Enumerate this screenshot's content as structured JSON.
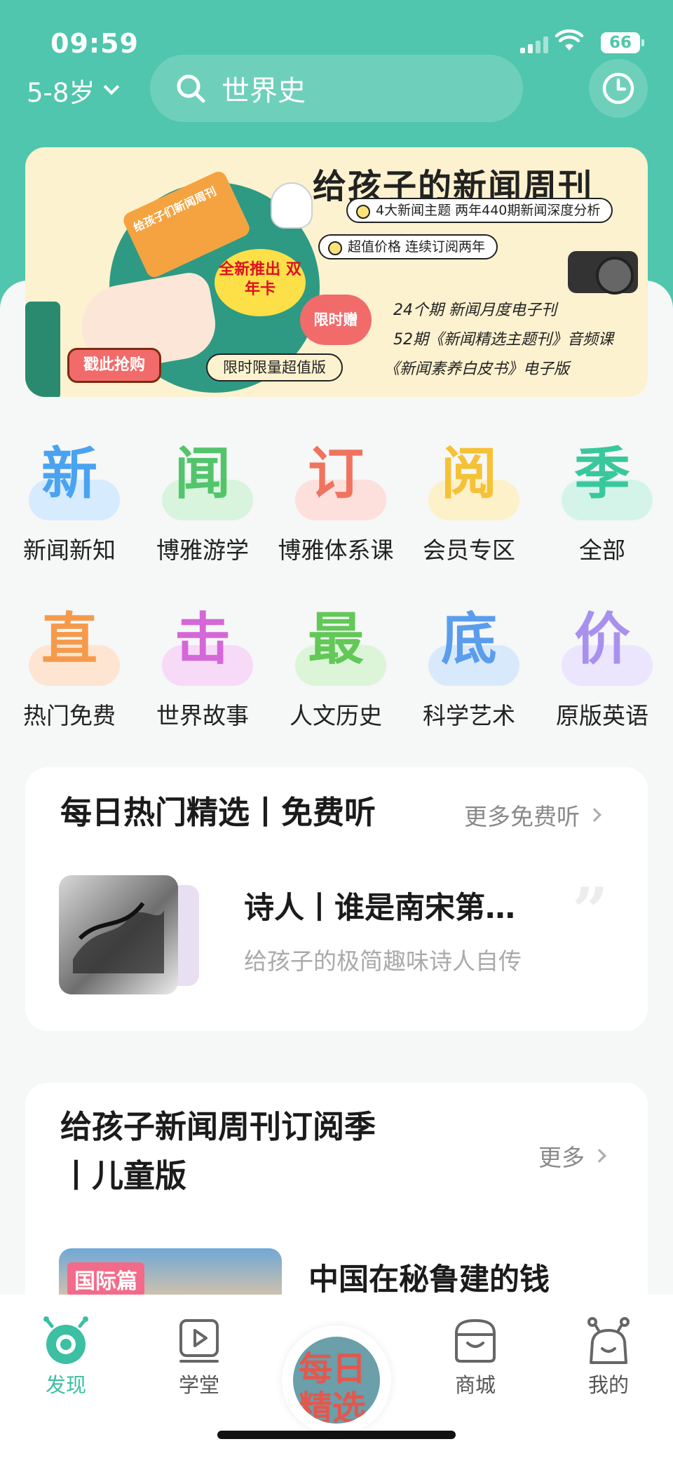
{
  "status": {
    "time": "09:59",
    "battery": "66"
  },
  "header": {
    "age_label": "5-8岁",
    "search_text": "世界史"
  },
  "banner": {
    "title": "给孩子的新闻周刊",
    "pill1": "4大新闻主题 两年440期新闻深度分析",
    "pill2": "超值价格 连续订阅两年",
    "badge": "全新推出 双年卡",
    "gift": "限时赠",
    "gift_line1": "24个期 新闻月度电子刊",
    "gift_line2": "52期《新闻精选主题刊》音频课",
    "gift_line3": "《新闻素养白皮书》电子版",
    "buy_button": "戳此抢购",
    "limit_text": "限时限量超值版",
    "card_text": "给孩子们新闻周刊"
  },
  "categories": [
    {
      "char": "新",
      "label": "新闻新知",
      "color": "#4aa3f0",
      "blob": "#d6ebfd"
    },
    {
      "char": "闻",
      "label": "博雅游学",
      "color": "#53c46b",
      "blob": "#d8f4dd"
    },
    {
      "char": "订",
      "label": "博雅体系课",
      "color": "#f0735f",
      "blob": "#fde0dc"
    },
    {
      "char": "阅",
      "label": "会员专区",
      "color": "#f5c237",
      "blob": "#fdf1c9"
    },
    {
      "char": "季",
      "label": "全部",
      "color": "#39c89c",
      "blob": "#d4f4ea"
    },
    {
      "char": "直",
      "label": "热门免费",
      "color": "#f59a4b",
      "blob": "#fde5d2"
    },
    {
      "char": "击",
      "label": "世界故事",
      "color": "#d468d8",
      "blob": "#f6daf7"
    },
    {
      "char": "最",
      "label": "人文历史",
      "color": "#62c857",
      "blob": "#dcf5d8"
    },
    {
      "char": "底",
      "label": "科学艺术",
      "color": "#5a9ded",
      "blob": "#d9e9fc"
    },
    {
      "char": "价",
      "label": "原版英语",
      "color": "#a891ee",
      "blob": "#ebe5fd"
    }
  ],
  "daily": {
    "title": "每日热门精选丨免费听",
    "more": "更多免费听",
    "item_title": "诗人丨谁是南宋第…",
    "item_sub": "给孩子的极简趣味诗人自传"
  },
  "weekly": {
    "title_line1": "给孩子新闻周刊订阅季",
    "title_line2": "丨儿童版",
    "more": "更多",
    "tag": "国际篇",
    "item_title": "中国在秘鲁建的钱"
  },
  "tabs": {
    "discover": "发现",
    "school": "学堂",
    "center_top": "每日",
    "center_bottom": "精选",
    "mall": "商城",
    "mine": "我的"
  },
  "colors": {
    "brand": "#4fc6ad",
    "tab_active": "#3cbfa3"
  }
}
